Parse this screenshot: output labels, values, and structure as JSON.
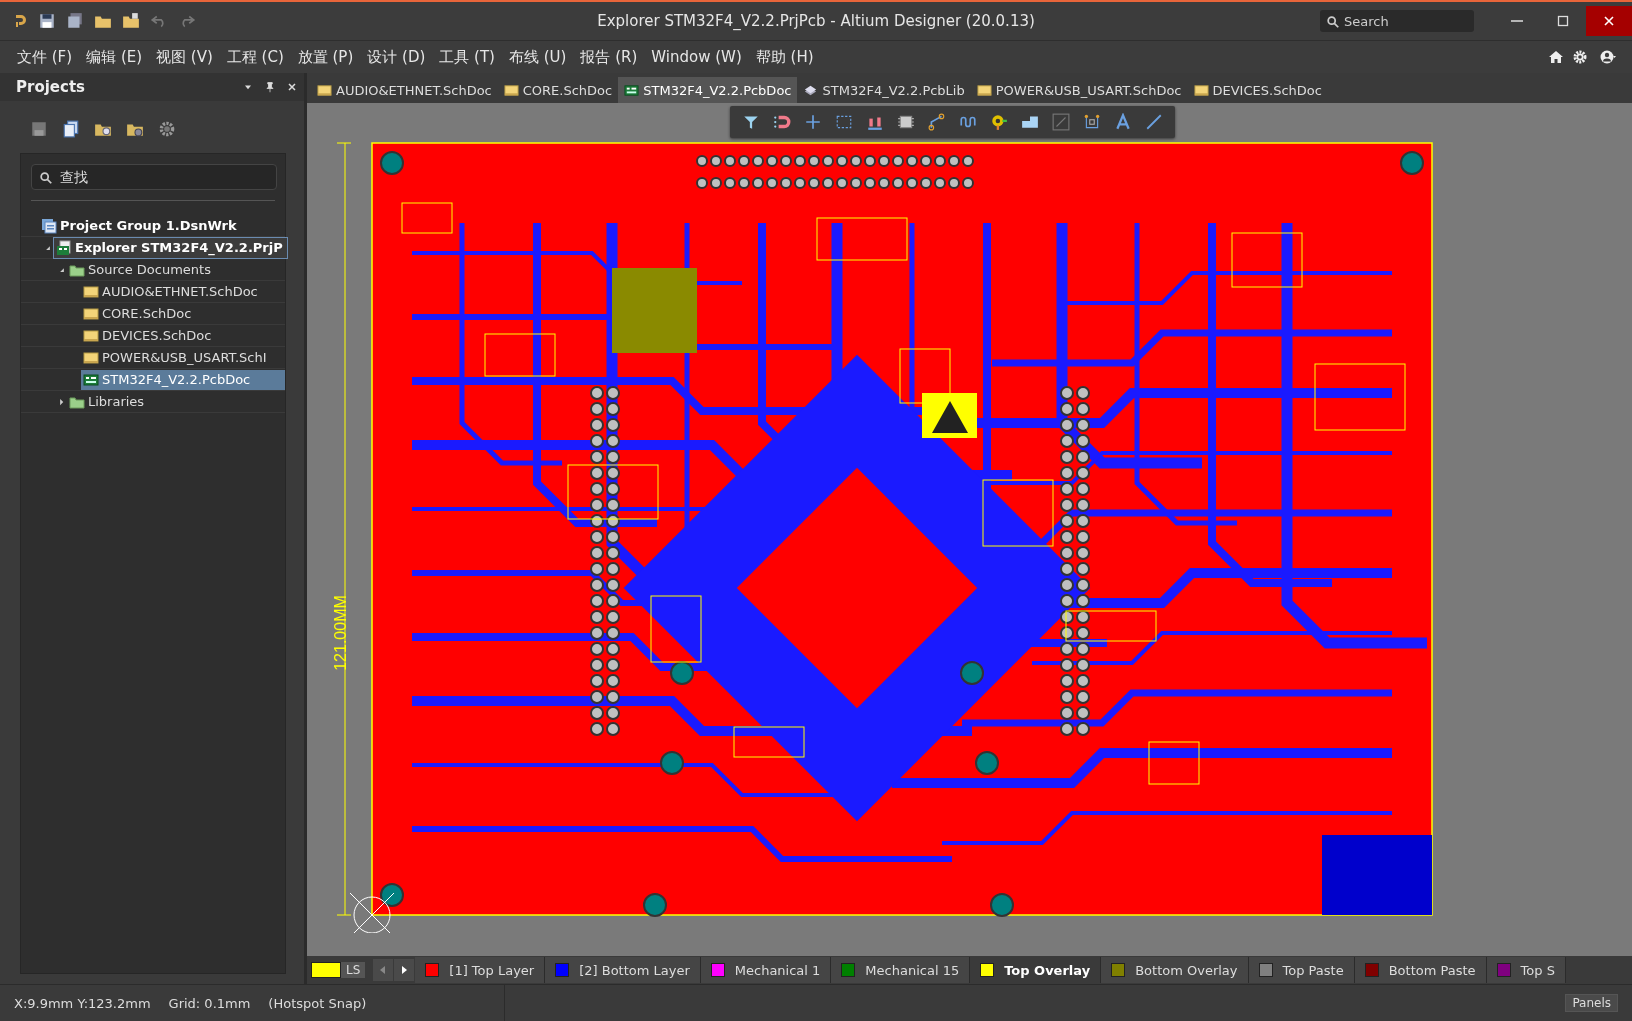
{
  "window": {
    "title": "Explorer STM32F4_V2.2.PrjPcb - Altium Designer (20.0.13)",
    "search": {
      "placeholder": "Search"
    }
  },
  "menu": [
    "文件 (F)",
    "编辑 (E)",
    "视图 (V)",
    "工程 (C)",
    "放置 (P)",
    "设计 (D)",
    "工具 (T)",
    "布线 (U)",
    "报告 (R)",
    "Window (W)",
    "帮助 (H)"
  ],
  "doc_tabs": [
    {
      "label": "AUDIO&ETHNET.SchDoc",
      "kind": "sch",
      "selected": false
    },
    {
      "label": "CORE.SchDoc",
      "kind": "sch",
      "selected": false
    },
    {
      "label": "STM32F4_V2.2.PcbDoc",
      "kind": "pcb",
      "selected": true
    },
    {
      "label": "STM32F4_V2.2.PcbLib",
      "kind": "lib",
      "selected": false
    },
    {
      "label": "POWER&USB_USART.SchDoc",
      "kind": "sch",
      "selected": false
    },
    {
      "label": "DEVICES.SchDoc",
      "kind": "sch",
      "selected": false
    }
  ],
  "projects_panel": {
    "title": "Projects",
    "search": {
      "placeholder": "查找"
    },
    "tree": [
      {
        "label": "Project Group 1.DsnWrk",
        "kind": "group",
        "selected": false,
        "children": [
          {
            "label": "Explorer STM32F4_V2.2.PrjP",
            "kind": "project",
            "expanded": true,
            "selected": false,
            "children": [
              {
                "label": "Source Documents",
                "kind": "folder",
                "expanded": true,
                "selected": false,
                "children": [
                  {
                    "label": "AUDIO&ETHNET.SchDoc",
                    "kind": "sch",
                    "selected": false
                  },
                  {
                    "label": "CORE.SchDoc",
                    "kind": "sch",
                    "selected": false
                  },
                  {
                    "label": "DEVICES.SchDoc",
                    "kind": "sch",
                    "selected": false
                  },
                  {
                    "label": "POWER&USB_USART.SchI",
                    "kind": "sch",
                    "selected": false
                  },
                  {
                    "label": "STM32F4_V2.2.PcbDoc",
                    "kind": "pcb",
                    "selected": true
                  }
                ]
              },
              {
                "label": "Libraries",
                "kind": "folder",
                "expanded": false,
                "selected": false
              }
            ]
          }
        ]
      }
    ]
  },
  "canvas": {
    "dimension_label": "121.00MM"
  },
  "layer_bar": {
    "ls_label": "LS",
    "layers": [
      {
        "label": "[1] Top Layer",
        "color": "#ff0000",
        "selected": false
      },
      {
        "label": "[2] Bottom Layer",
        "color": "#0000ff",
        "selected": false
      },
      {
        "label": "Mechanical 1",
        "color": "#ff00ff",
        "selected": false
      },
      {
        "label": "Mechanical 15",
        "color": "#008000",
        "selected": false
      },
      {
        "label": "Top Overlay",
        "color": "#ffff00",
        "selected": true
      },
      {
        "label": "Bottom Overlay",
        "color": "#808000",
        "selected": false
      },
      {
        "label": "Top Paste",
        "color": "#808080",
        "selected": false
      },
      {
        "label": "Bottom Paste",
        "color": "#800000",
        "selected": false
      },
      {
        "label": "Top S",
        "color": "#800080",
        "selected": false
      }
    ]
  },
  "status_bar": {
    "coordinates": "X:9.9mm Y:123.2mm",
    "grid": "Grid: 0.1mm",
    "snap": "(Hotspot Snap)",
    "panels_button": "Panels"
  }
}
